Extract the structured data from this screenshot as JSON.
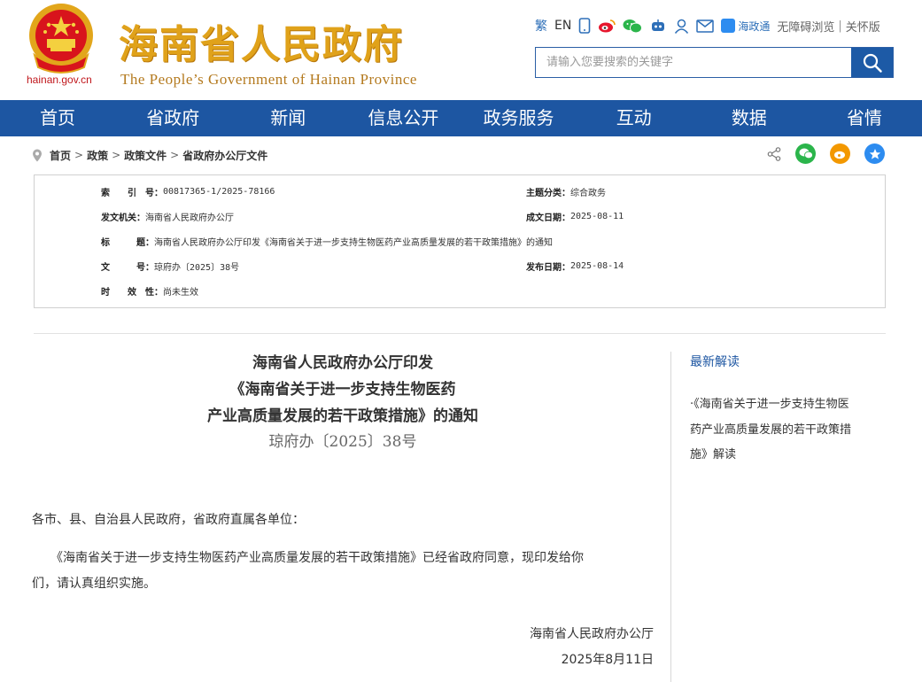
{
  "header": {
    "domain": "hainan.gov.cn",
    "title": "海南省人民政府",
    "subtitle": "The People’s Government  of Hainan Province",
    "tools": {
      "traditional": "繁",
      "english": "EN",
      "hainan_tong": "海政通",
      "accessible": "无障碍浏览",
      "sep": "|",
      "elder": "关怀版"
    },
    "search": {
      "placeholder": "请输入您要搜索的关键字"
    }
  },
  "nav": [
    "首页",
    "省政府",
    "新闻",
    "信息公开",
    "政务服务",
    "互动",
    "数据",
    "省情"
  ],
  "breadcrumb": [
    "首页",
    "政策",
    "政策文件",
    "省政府办公厅文件"
  ],
  "breadcrumb_sep": ">",
  "info": {
    "index_label": "索　　引　号：",
    "index_value": "00817365-1/2025-78166",
    "category_label": "主题分类：",
    "category_value": "综合政务",
    "issuer_label": "发文机关：",
    "issuer_value": "海南省人民政府办公厅",
    "created_label": "成文日期：",
    "created_value": "2025-08-11",
    "title_label": "标　　　题：",
    "title_value": "海南省人民政府办公厅印发《海南省关于进一步支持生物医药产业高质量发展的若干政策措施》的通知",
    "docno_label": "文　　　号：",
    "docno_value": "琼府办〔2025〕38号",
    "published_label": "发布日期：",
    "published_value": "2025-08-14",
    "validity_label": "时　　效　性：",
    "validity_value": "尚未生效"
  },
  "article": {
    "title_lines": [
      "海南省人民政府办公厅印发",
      "《海南省关于进一步支持生物医药",
      "产业高质量发展的若干政策措施》的通知"
    ],
    "doc_number": "琼府办〔2025〕38号",
    "salutation": "各市、县、自治县人民政府，省政府直属各单位：",
    "para1_line1": "　　《海南省关于进一步支持生物医药产业高质量发展的若干政策措施》已经省政府同意，现印发给你",
    "para1_line2": "们，请认真组织实施。",
    "signature": "海南省人民政府办公厅",
    "date": "2025年8月11日"
  },
  "sidebar": {
    "title": "最新解读",
    "item_lines": [
      "·《海南省关于进一步支持生物医",
      "药产业高质量发展的若干政策措",
      "施》解读"
    ]
  },
  "colors": {
    "nav_bg": "#1d56a2",
    "title_gold": "#e0a21a",
    "emblem_red": "#d8141c"
  }
}
